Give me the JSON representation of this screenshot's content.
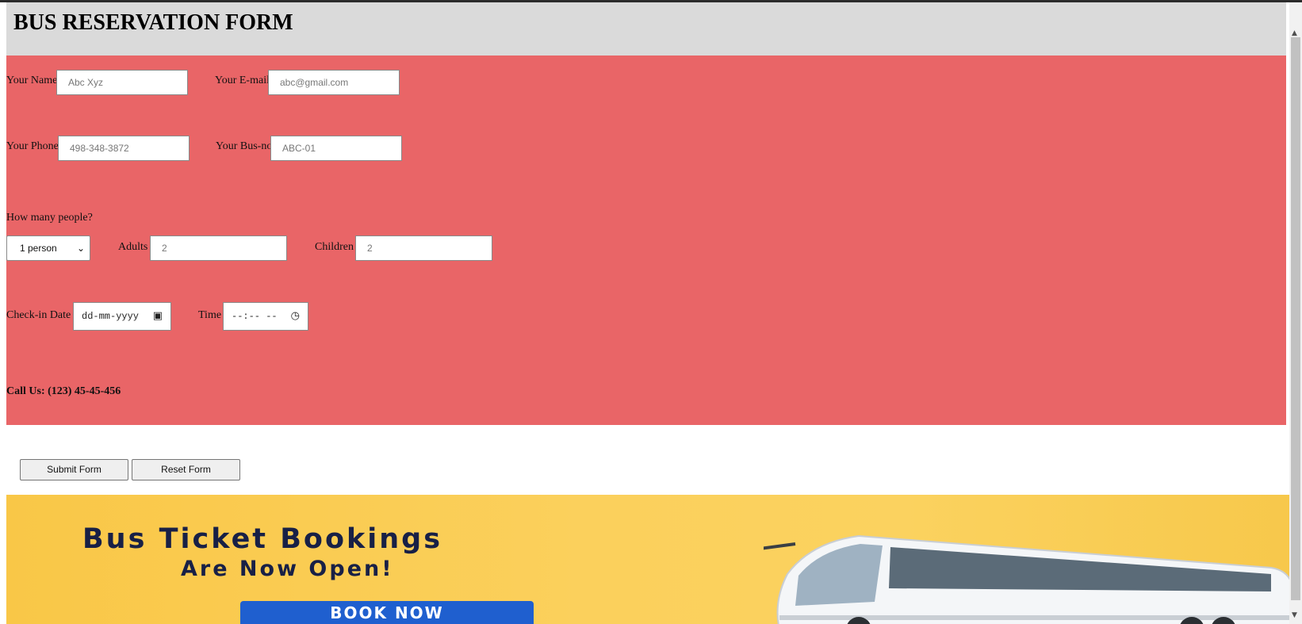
{
  "header": {
    "title": "BUS RESERVATION FORM"
  },
  "form": {
    "name": {
      "label": "Your Name",
      "placeholder": "Abc Xyz"
    },
    "email": {
      "label": "Your E-mail",
      "placeholder": "abc@gmail.com"
    },
    "phone": {
      "label": "Your Phone",
      "placeholder": "498-348-3872"
    },
    "bus_no": {
      "label": "Your Bus-no",
      "placeholder": "ABC-01"
    },
    "people_question": "How many people?",
    "people_select": {
      "value": "1 person"
    },
    "adults": {
      "label": "Adults",
      "value": "2"
    },
    "children": {
      "label": "Children",
      "value": "2"
    },
    "checkin": {
      "label": "Check-in Date",
      "placeholder": "dd-mm-yyyy"
    },
    "time": {
      "label": "Time",
      "placeholder": "--:-- --"
    },
    "call_us": "Call Us: (123) 45-45-456"
  },
  "buttons": {
    "submit": "Submit Form",
    "reset": "Reset Form"
  },
  "banner": {
    "title": "Bus Ticket Bookings",
    "subtitle": "Are Now Open!",
    "cta": "BOOK NOW"
  },
  "colors": {
    "form_bg": "#e96567",
    "header_bg": "#dadada",
    "banner_bg": "#fbd05c",
    "cta_bg": "#1f5fcf"
  }
}
